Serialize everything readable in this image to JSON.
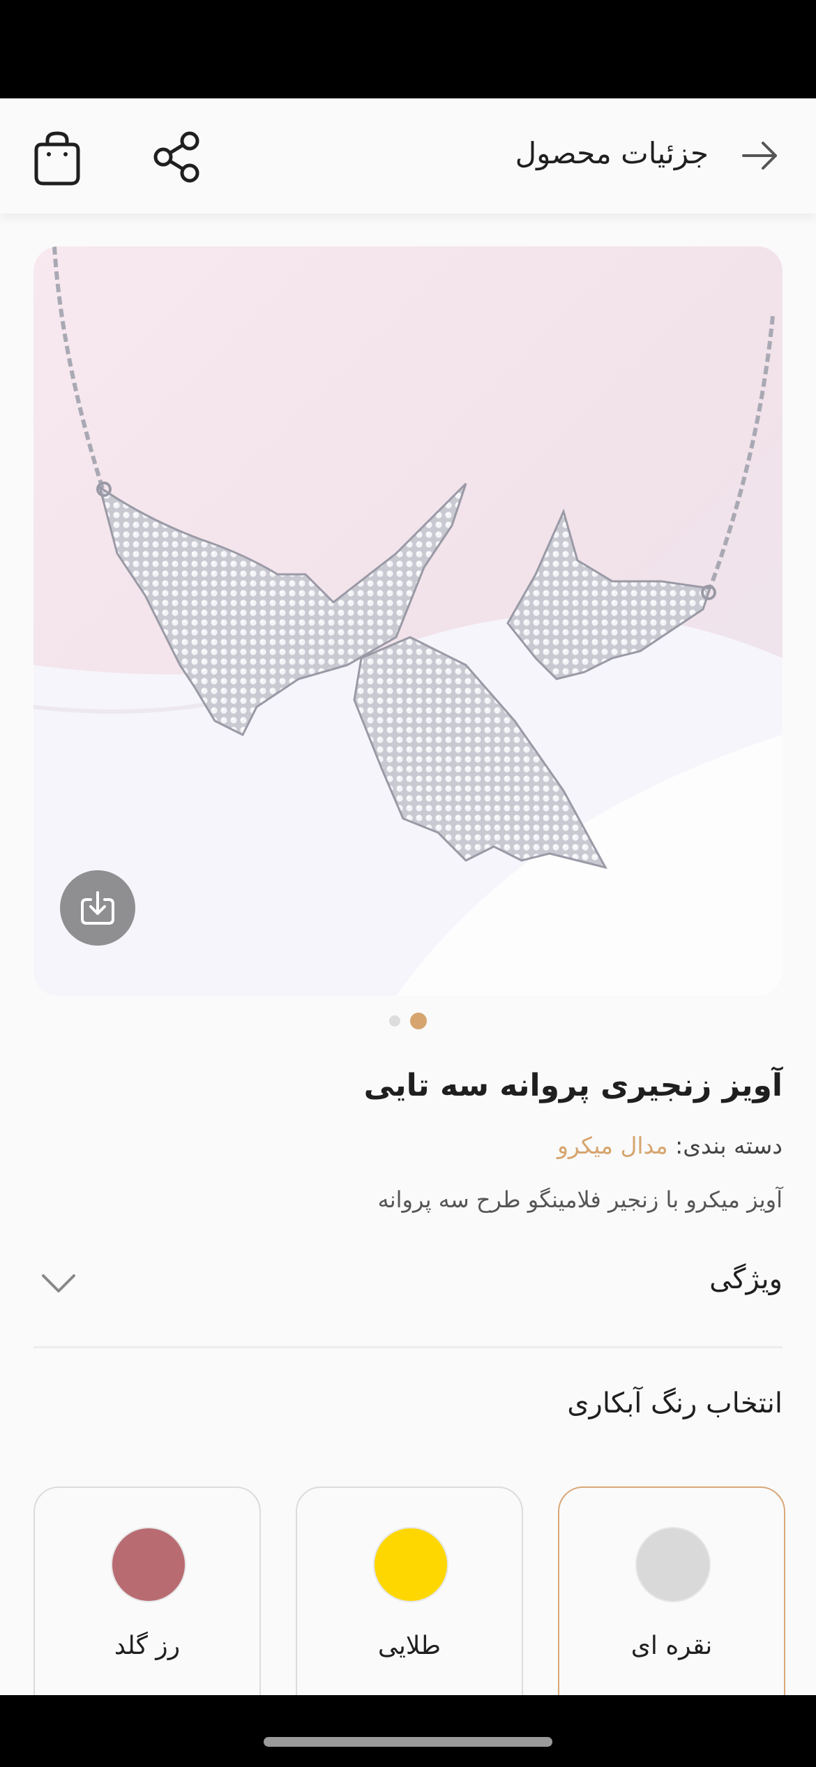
{
  "header": {
    "title": "جزئیات محصول",
    "back_icon": "arrow-right-icon",
    "share_icon": "share-icon",
    "bag_icon": "shopping-bag-icon"
  },
  "gallery": {
    "image_subject": "silver butterfly chain pendant",
    "download_icon": "download-icon",
    "page_count": 2,
    "active_page": 2
  },
  "product": {
    "title": "آویز زنجیری پروانه سه تایی",
    "category_label": "دسته بندی:",
    "category_value": "مدال میکرو",
    "description": "آویز میکرو با زنجیر فلامینگو طرح سه پروانه"
  },
  "features": {
    "label": "ویژگی",
    "icon": "chevron-down-icon"
  },
  "color_selection": {
    "title": "انتخاب رنگ آبکاری",
    "options": [
      {
        "name": "نقره ای",
        "color": "#d9d9d9",
        "selected": true
      },
      {
        "name": "طلایی",
        "color": "#ffd700",
        "selected": false
      },
      {
        "name": "رز گلد",
        "color": "#b86c72",
        "selected": false
      }
    ]
  },
  "colors": {
    "accent": "#d6a56f",
    "selected_border": "#d9a878"
  }
}
